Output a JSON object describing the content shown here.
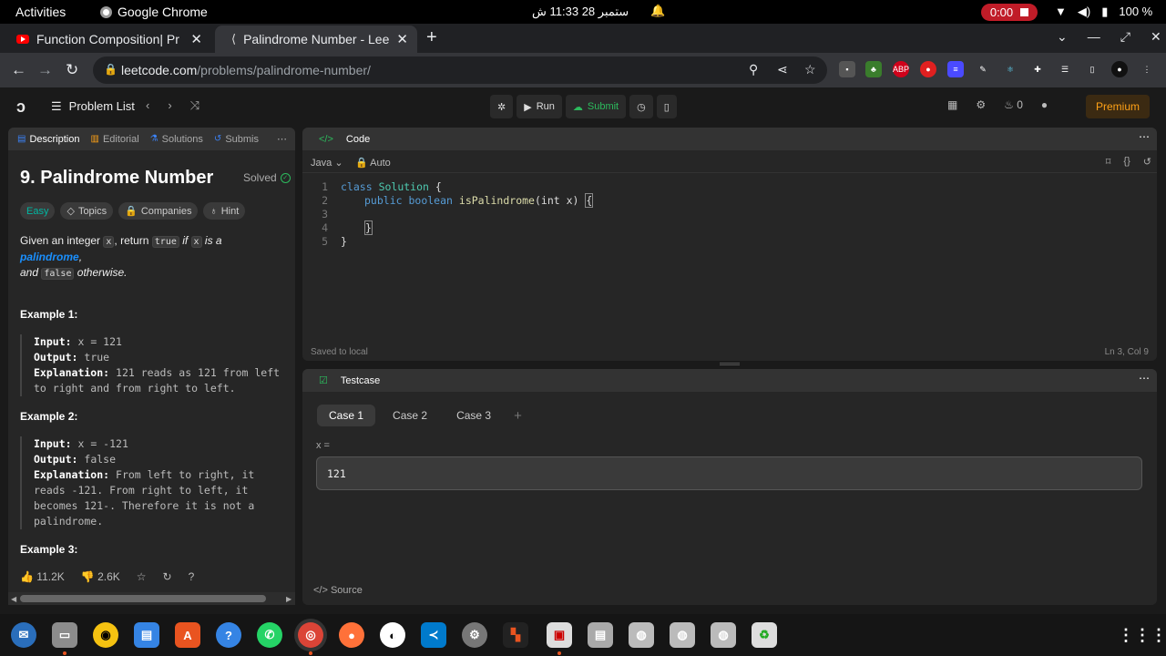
{
  "system": {
    "activities": "Activities",
    "app_name": "Google Chrome",
    "clock": "ستمبر 28  11:33 ش",
    "recording": "0:00",
    "battery": "100 %"
  },
  "browser": {
    "tabs": [
      {
        "title": "Function Composition| Pr"
      },
      {
        "title": "Palindrome Number - Lee"
      }
    ],
    "url_host": "leetcode.com",
    "url_path": "/problems/palindrome-number/"
  },
  "header": {
    "problem_list": "Problem List",
    "run": "Run",
    "submit": "Submit",
    "streak": "0",
    "premium": "Premium"
  },
  "left": {
    "tabs": [
      "Description",
      "Editorial",
      "Solutions",
      "Submis"
    ],
    "title": "9. Palindrome Number",
    "solved": "Solved",
    "chips": [
      "Easy",
      "Topics",
      "Companies",
      "Hint"
    ],
    "desc": {
      "p1": "Given an integer ",
      "x": "x",
      "p2": ", return ",
      "true": "true",
      "p3": " if ",
      "p4": " is a ",
      "link": "palindrome",
      "p5": ",",
      "p6": "and ",
      "false": "false",
      "p7": " otherwise."
    },
    "examples": [
      {
        "heading": "Example 1:",
        "input": "x = 121",
        "output": "true",
        "explanation": "121 reads as 121 from left to right and from right to left."
      },
      {
        "heading": "Example 2:",
        "input": "x = -121",
        "output": "false",
        "explanation": "From left to right, it reads -121. From right to left, it becomes 121-. Therefore it is not a palindrome."
      }
    ],
    "example3": "Example 3:",
    "labels": {
      "input": "Input:",
      "output": "Output:",
      "explanation": "Explanation:"
    },
    "likes": "11.2K",
    "dislikes": "2.6K"
  },
  "code": {
    "header": "Code",
    "language": "Java",
    "mode": "Auto",
    "lines": [
      "1",
      "2",
      "3",
      "4",
      "5"
    ],
    "saved": "Saved to local",
    "position": "Ln 3, Col 9",
    "tokens": {
      "class": "class",
      "Solution": "Solution",
      "open": " {",
      "public": "public",
      "boolean": "boolean",
      "fn": "isPalindrome",
      "params": "(int x) ",
      "brace_open": "{",
      "brace_close": "}",
      "class_close": "}"
    }
  },
  "testcase": {
    "header": "Testcase",
    "cases": [
      "Case 1",
      "Case 2",
      "Case 3"
    ],
    "plus": "+",
    "var_label": "x =",
    "value": "121",
    "source": "Source"
  }
}
